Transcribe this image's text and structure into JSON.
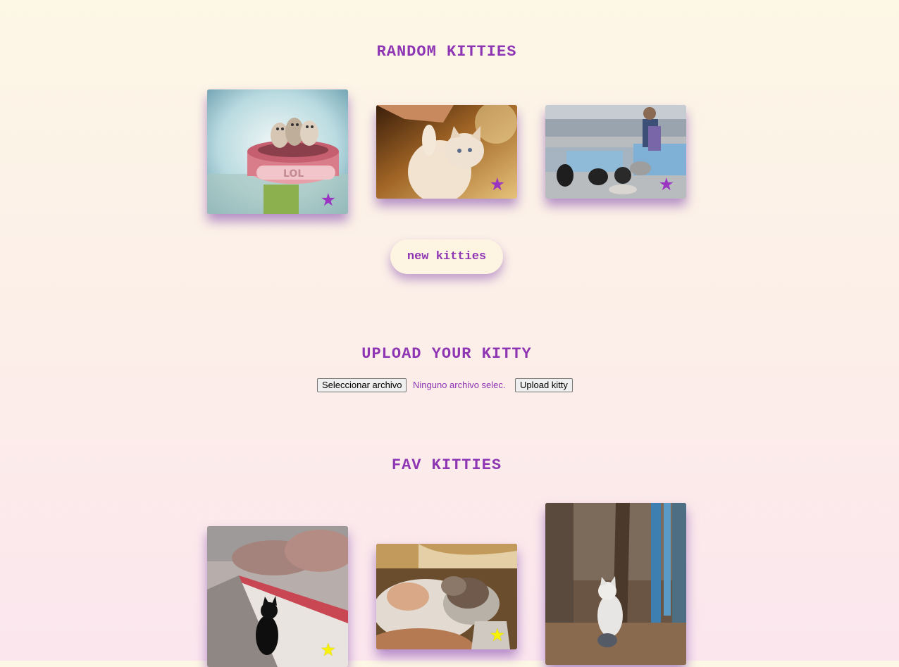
{
  "random": {
    "title": "RANDOM KITTIES",
    "new_button": "new kitties",
    "star_icon": "★",
    "star_color": "#9a35c2"
  },
  "upload": {
    "title": "UPLOAD YOUR KITTY",
    "choose_file_label": "Seleccionar archivo",
    "file_status": "Ninguno archivo selec.",
    "upload_button": "Upload kitty"
  },
  "favs": {
    "title": "FAV KITTIES",
    "star_icon": "★",
    "star_color": "#f7f205"
  },
  "colors": {
    "accent": "#8e35b3",
    "button_bg": "#fdf5e1"
  }
}
